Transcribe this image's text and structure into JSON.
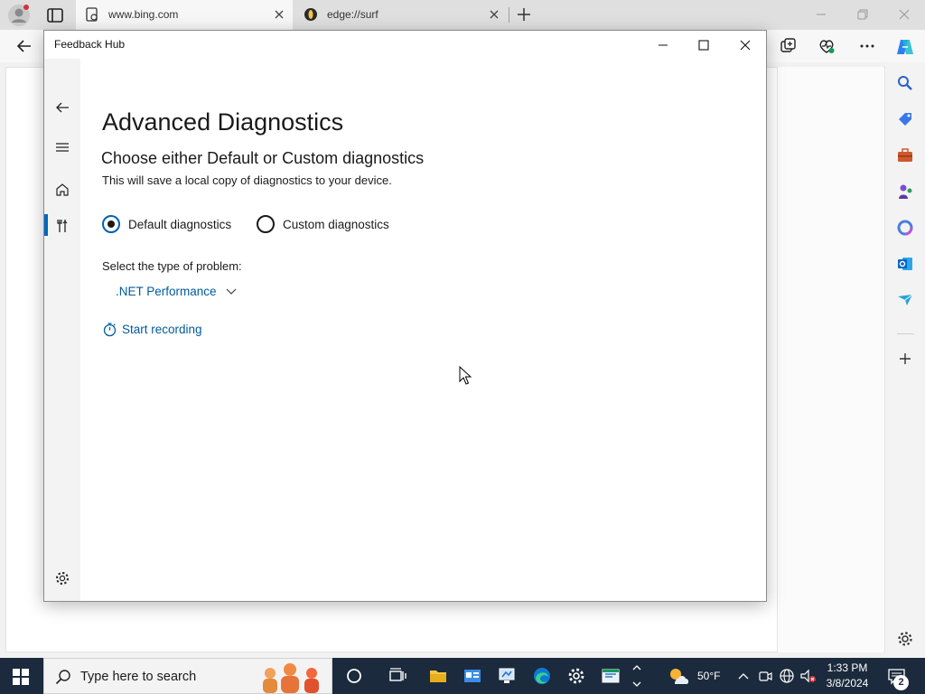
{
  "browser": {
    "tabs": [
      {
        "title": "www.bing.com",
        "active": true
      },
      {
        "title": "edge://surf",
        "active": false
      }
    ]
  },
  "window": {
    "title": "Feedback Hub"
  },
  "page": {
    "heading": "Advanced Diagnostics",
    "subheading": "Choose either Default or Custom diagnostics",
    "description": "This will save a local copy of diagnostics to your device.",
    "radio_default_label": "Default diagnostics",
    "radio_custom_label": "Custom diagnostics",
    "selected_option": "Default diagnostics",
    "problem_type_label": "Select the type of problem:",
    "problem_type_value": ".NET Performance",
    "start_recording_label": "Start recording"
  },
  "taskbar": {
    "search_placeholder": "Type here to search",
    "temperature": "50°F",
    "time": "1:33 PM",
    "date": "3/8/2024",
    "notification_count": "2"
  },
  "colors": {
    "accent": "#005fb8",
    "link": "#005a9e",
    "taskbar": "#1c2a3d"
  }
}
